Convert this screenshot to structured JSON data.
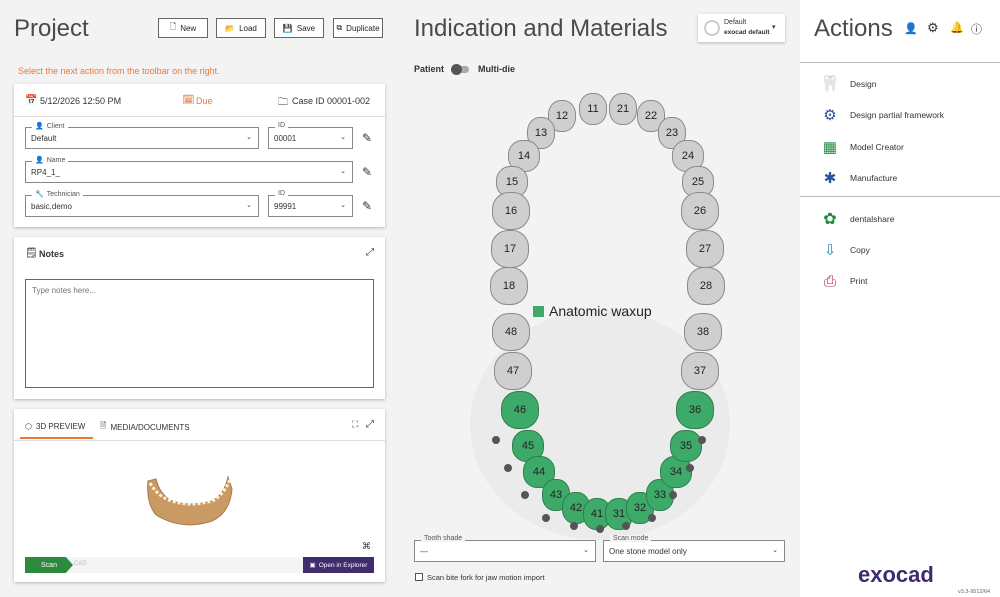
{
  "project": {
    "title": "Project",
    "buttons": {
      "new": "New",
      "load": "Load",
      "save": "Save",
      "duplicate": "Duplicate"
    },
    "hint": "Select the next action from the toolbar on the right."
  },
  "case": {
    "datetime": "5/12/2026 12:50 PM",
    "due": "Due",
    "case_id_label": "Case ID",
    "case_id": "00001-002"
  },
  "client": {
    "label": "Client",
    "value": "Default",
    "id_label": "ID",
    "id_value": "00001"
  },
  "name": {
    "label": "Name",
    "value": "RP4_1_"
  },
  "technician": {
    "label": "Technician",
    "value": "basic,demo",
    "id_label": "ID",
    "id_value": "99991"
  },
  "notes": {
    "title": "Notes",
    "placeholder": "Type notes here..."
  },
  "preview": {
    "tab_3d": "3D PREVIEW",
    "tab_media": "MEDIA/DOCUMENTS",
    "scan": "Scan",
    "cad": "CAD",
    "open_explorer": "Open in Explorer"
  },
  "indication": {
    "title": "Indication and Materials",
    "preset_line1": "Default",
    "preset_line2": "exocad default",
    "patient": "Patient",
    "multidie": "Multi-die",
    "legend": "Anatomic waxup",
    "tooth_shade_label": "Tooth shade",
    "tooth_shade_value": "---",
    "scan_mode_label": "Scan mode",
    "scan_mode_value": "One stone model only",
    "scan_bite": "Scan bite fork for jaw motion import"
  },
  "teeth": {
    "upper": [
      "11",
      "12",
      "13",
      "14",
      "15",
      "16",
      "17",
      "18",
      "21",
      "22",
      "23",
      "24",
      "25",
      "26",
      "27",
      "28"
    ],
    "lower": [
      "48",
      "47",
      "46",
      "45",
      "44",
      "43",
      "42",
      "41",
      "31",
      "32",
      "33",
      "34",
      "35",
      "36",
      "37",
      "38"
    ]
  },
  "actions": {
    "title": "Actions",
    "items": [
      "Design",
      "Design partial framework",
      "Model Creator",
      "Manufacture",
      "dentalshare",
      "Copy",
      "Print"
    ],
    "brand": "exocad",
    "version": "v3.3-9512/64"
  },
  "colors": {
    "accent": "#e87a3a",
    "green": "#3daa6a",
    "purple": "#3f2b6e"
  }
}
